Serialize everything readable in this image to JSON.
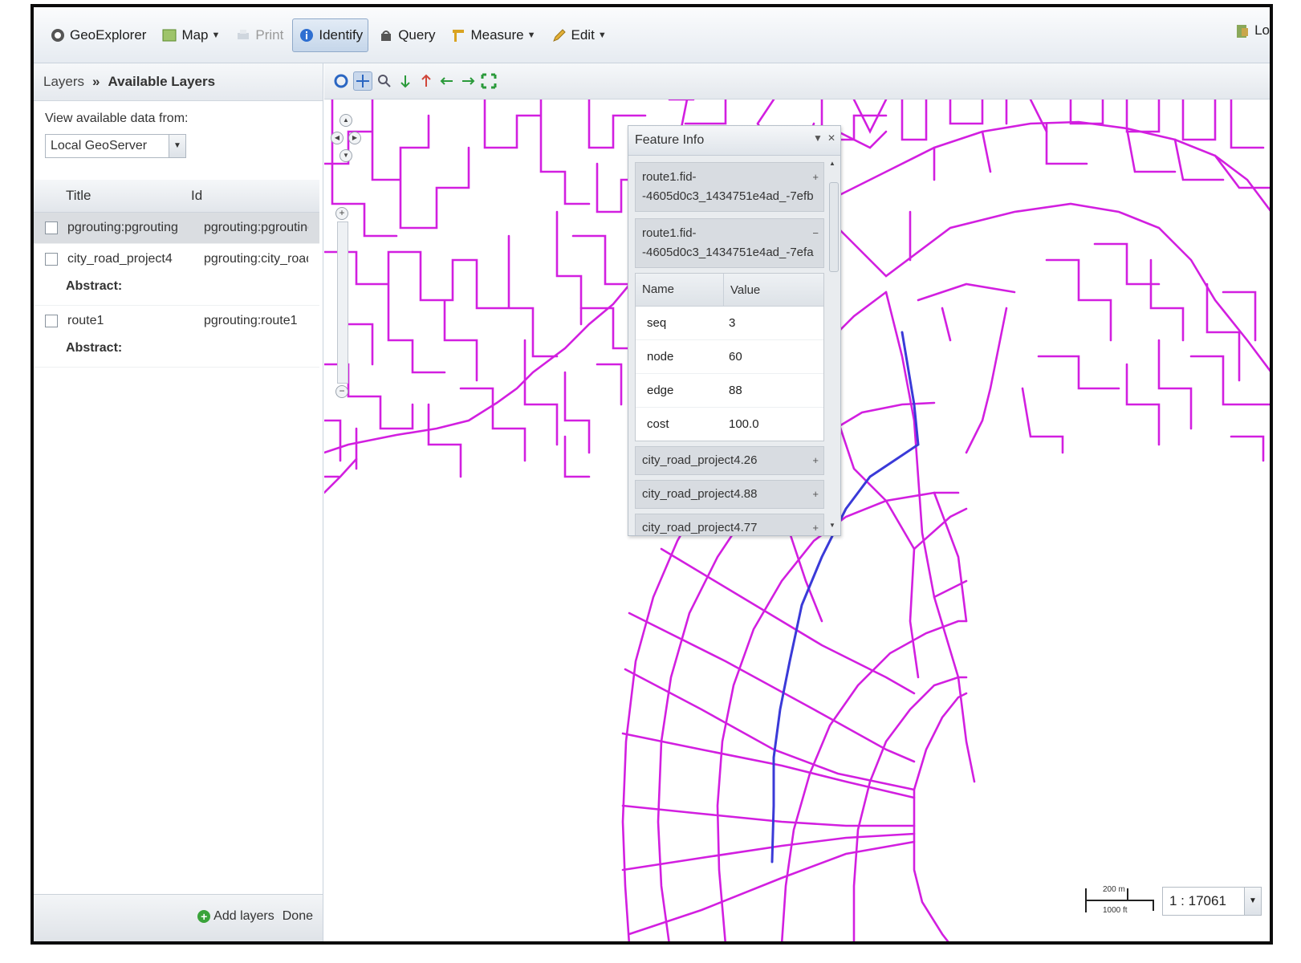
{
  "toolbar": {
    "app_label": "GeoExplorer",
    "map_label": "Map",
    "print_label": "Print",
    "identify_label": "Identify",
    "query_label": "Query",
    "measure_label": "Measure",
    "edit_label": "Edit",
    "login_label": "Lo"
  },
  "left_panel": {
    "breadcrumb": {
      "root": "Layers",
      "sep": "»",
      "current": "Available Layers"
    },
    "source_label": "View available data from:",
    "source_value": "Local GeoServer",
    "columns": {
      "title": "Title",
      "id": "Id"
    },
    "rows": [
      {
        "title": "pgrouting:pgrouting",
        "id": "pgrouting:pgrouting",
        "abstract": ""
      },
      {
        "title": "city_road_project4",
        "id": "pgrouting:city_road_...",
        "abstract": "Abstract:"
      },
      {
        "title": "route1",
        "id": "pgrouting:route1",
        "abstract": "Abstract:"
      }
    ],
    "add_layers_label": "Add layers",
    "done_label": "Done"
  },
  "feature_info": {
    "title": "Feature Info",
    "group1": "route1.fid--4605d0c3_1434751e4ad_-7efb",
    "group2": "route1.fid--4605d0c3_1434751e4ad_-7efa",
    "name_header": "Name",
    "value_header": "Value",
    "attributes": [
      {
        "name": "seq",
        "value": "3"
      },
      {
        "name": "node",
        "value": "60"
      },
      {
        "name": "edge",
        "value": "88"
      },
      {
        "name": "cost",
        "value": "100.0"
      }
    ],
    "items": [
      "city_road_project4.26",
      "city_road_project4.88",
      "city_road_project4.77"
    ]
  },
  "scale": {
    "top": "200 m",
    "bottom": "1000 ft",
    "value": "1 : 17061"
  },
  "colors": {
    "road": "#d21fe0",
    "route": "#3a3ad8",
    "toolbar_bg": "#e6ebf1",
    "selected_row": "#dadde1"
  },
  "icons": [
    "geoexplorer-icon",
    "map-icon",
    "print-icon",
    "identify-icon",
    "query-icon",
    "measure-icon",
    "edit-icon",
    "login-icon",
    "pan-icon",
    "zoom-in-icon",
    "zoom-out-icon",
    "back-icon",
    "forward-icon",
    "extent-icon"
  ]
}
